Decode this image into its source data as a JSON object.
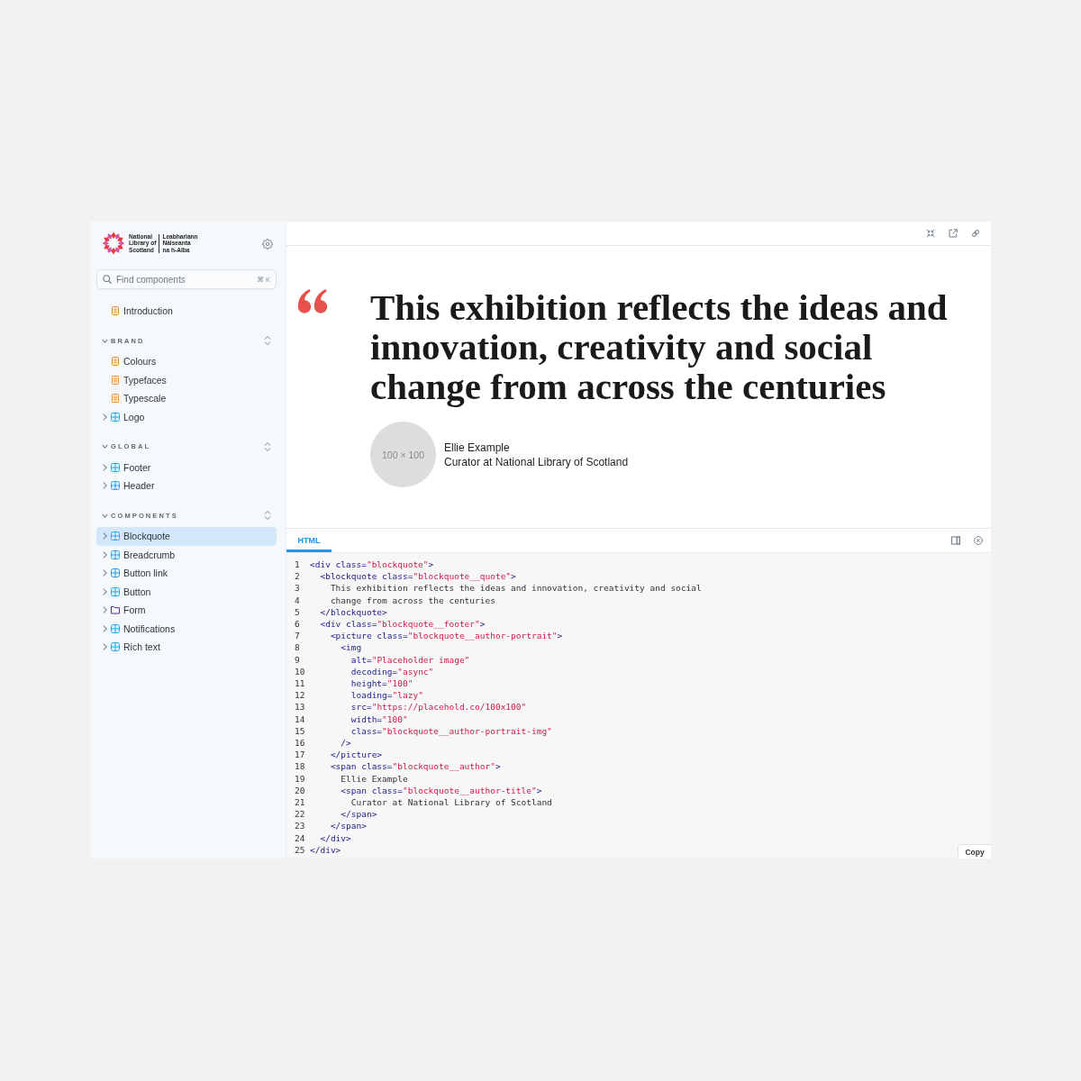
{
  "sidebar": {
    "logo": {
      "english": [
        "National",
        "Library of",
        "Scotland"
      ],
      "gaelic": [
        "Leabharlann",
        "Nàiseanta",
        "na h-Alba"
      ]
    },
    "search": {
      "placeholder": "Find components",
      "shortcut": "⌘ K"
    },
    "top_items": [
      {
        "label": "Introduction",
        "kind": "document",
        "selected": false
      }
    ],
    "sections": [
      {
        "title": "BRAND",
        "expanded": true,
        "items": [
          {
            "label": "Colours",
            "kind": "document",
            "selected": false
          },
          {
            "label": "Typefaces",
            "kind": "document",
            "selected": false
          },
          {
            "label": "Typescale",
            "kind": "document",
            "selected": false
          },
          {
            "label": "Logo",
            "kind": "component",
            "expanded": false,
            "selected": false
          }
        ]
      },
      {
        "title": "GLOBAL",
        "expanded": true,
        "items": [
          {
            "label": "Footer",
            "kind": "component",
            "expanded": false,
            "selected": false
          },
          {
            "label": "Header",
            "kind": "component",
            "expanded": false,
            "selected": false
          }
        ]
      },
      {
        "title": "COMPONENTS",
        "expanded": true,
        "items": [
          {
            "label": "Blockquote",
            "kind": "component",
            "expanded": false,
            "selected": true
          },
          {
            "label": "Breadcrumb",
            "kind": "component",
            "expanded": false,
            "selected": false
          },
          {
            "label": "Button link",
            "kind": "component",
            "expanded": false,
            "selected": false
          },
          {
            "label": "Button",
            "kind": "component",
            "expanded": false,
            "selected": false
          },
          {
            "label": "Form",
            "kind": "folder",
            "expanded": false,
            "selected": false
          },
          {
            "label": "Notifications",
            "kind": "component",
            "expanded": false,
            "selected": false
          },
          {
            "label": "Rich text",
            "kind": "component",
            "expanded": false,
            "selected": false
          }
        ]
      }
    ]
  },
  "preview": {
    "quote": "This exhibition reflects the ideas and innovation, creativity and social change from across the centuries",
    "portrait_label": "100 × 100",
    "author": "Ellie Example",
    "author_title": "Curator at National Library of Scotland"
  },
  "code_panel": {
    "tabs": [
      {
        "label": "HTML",
        "selected": true
      }
    ],
    "lines": [
      {
        "number": "1",
        "tokens": [
          {
            "kind": "markup",
            "text": "<div class="
          },
          {
            "kind": "string",
            "text": "\"blockquote\""
          },
          {
            "kind": "markup",
            "text": ">"
          }
        ]
      },
      {
        "number": "2",
        "tokens": [
          {
            "kind": "markup",
            "text": "  <blockquote class="
          },
          {
            "kind": "string",
            "text": "\"blockquote__quote\""
          },
          {
            "kind": "markup",
            "text": ">"
          }
        ]
      },
      {
        "number": "3",
        "tokens": [
          {
            "kind": "text",
            "text": "    This exhibition reflects the ideas and innovation, creativity and social"
          }
        ]
      },
      {
        "number": "4",
        "tokens": [
          {
            "kind": "text",
            "text": "    change from across the centuries"
          }
        ]
      },
      {
        "number": "5",
        "tokens": [
          {
            "kind": "markup",
            "text": "  </blockquote>"
          }
        ]
      },
      {
        "number": "6",
        "tokens": [
          {
            "kind": "markup",
            "text": "  <div class="
          },
          {
            "kind": "string",
            "text": "\"blockquote__footer\""
          },
          {
            "kind": "markup",
            "text": ">"
          }
        ]
      },
      {
        "number": "7",
        "tokens": [
          {
            "kind": "markup",
            "text": "    <picture class="
          },
          {
            "kind": "string",
            "text": "\"blockquote__author-portrait\""
          },
          {
            "kind": "markup",
            "text": ">"
          }
        ]
      },
      {
        "number": "8",
        "tokens": [
          {
            "kind": "markup",
            "text": "      <img"
          }
        ]
      },
      {
        "number": "9",
        "tokens": [
          {
            "kind": "markup",
            "text": "        alt="
          },
          {
            "kind": "string",
            "text": "\"Placeholder image\""
          }
        ]
      },
      {
        "number": "10",
        "tokens": [
          {
            "kind": "markup",
            "text": "        decoding="
          },
          {
            "kind": "string",
            "text": "\"async\""
          }
        ]
      },
      {
        "number": "11",
        "tokens": [
          {
            "kind": "markup",
            "text": "        height="
          },
          {
            "kind": "string",
            "text": "\"100\""
          }
        ]
      },
      {
        "number": "12",
        "tokens": [
          {
            "kind": "markup",
            "text": "        loading="
          },
          {
            "kind": "string",
            "text": "\"lazy\""
          }
        ]
      },
      {
        "number": "13",
        "tokens": [
          {
            "kind": "markup",
            "text": "        src="
          },
          {
            "kind": "string",
            "text": "\"https://placehold.co/100x100\""
          }
        ]
      },
      {
        "number": "14",
        "tokens": [
          {
            "kind": "markup",
            "text": "        width="
          },
          {
            "kind": "string",
            "text": "\"100\""
          }
        ]
      },
      {
        "number": "15",
        "tokens": [
          {
            "kind": "markup",
            "text": "        class="
          },
          {
            "kind": "string",
            "text": "\"blockquote__author-portrait-img\""
          }
        ]
      },
      {
        "number": "16",
        "tokens": [
          {
            "kind": "markup",
            "text": "      />"
          }
        ]
      },
      {
        "number": "17",
        "tokens": [
          {
            "kind": "markup",
            "text": "    </picture>"
          }
        ]
      },
      {
        "number": "18",
        "tokens": [
          {
            "kind": "markup",
            "text": "    <span class="
          },
          {
            "kind": "string",
            "text": "\"blockquote__author\""
          },
          {
            "kind": "markup",
            "text": ">"
          }
        ]
      },
      {
        "number": "19",
        "tokens": [
          {
            "kind": "text",
            "text": "      Ellie Example"
          }
        ]
      },
      {
        "number": "20",
        "tokens": [
          {
            "kind": "markup",
            "text": "      <span class="
          },
          {
            "kind": "string",
            "text": "\"blockquote__author-title\""
          },
          {
            "kind": "markup",
            "text": ">"
          }
        ]
      },
      {
        "number": "21",
        "tokens": [
          {
            "kind": "text",
            "text": "        Curator at National Library of Scotland"
          }
        ]
      },
      {
        "number": "22",
        "tokens": [
          {
            "kind": "markup",
            "text": "      </span>"
          }
        ]
      },
      {
        "number": "23",
        "tokens": [
          {
            "kind": "markup",
            "text": "    </span>"
          }
        ]
      },
      {
        "number": "24",
        "tokens": [
          {
            "kind": "markup",
            "text": "  </div>"
          }
        ]
      },
      {
        "number": "25",
        "tokens": [
          {
            "kind": "markup",
            "text": "</div>"
          }
        ]
      }
    ],
    "copy_button": "Copy"
  }
}
